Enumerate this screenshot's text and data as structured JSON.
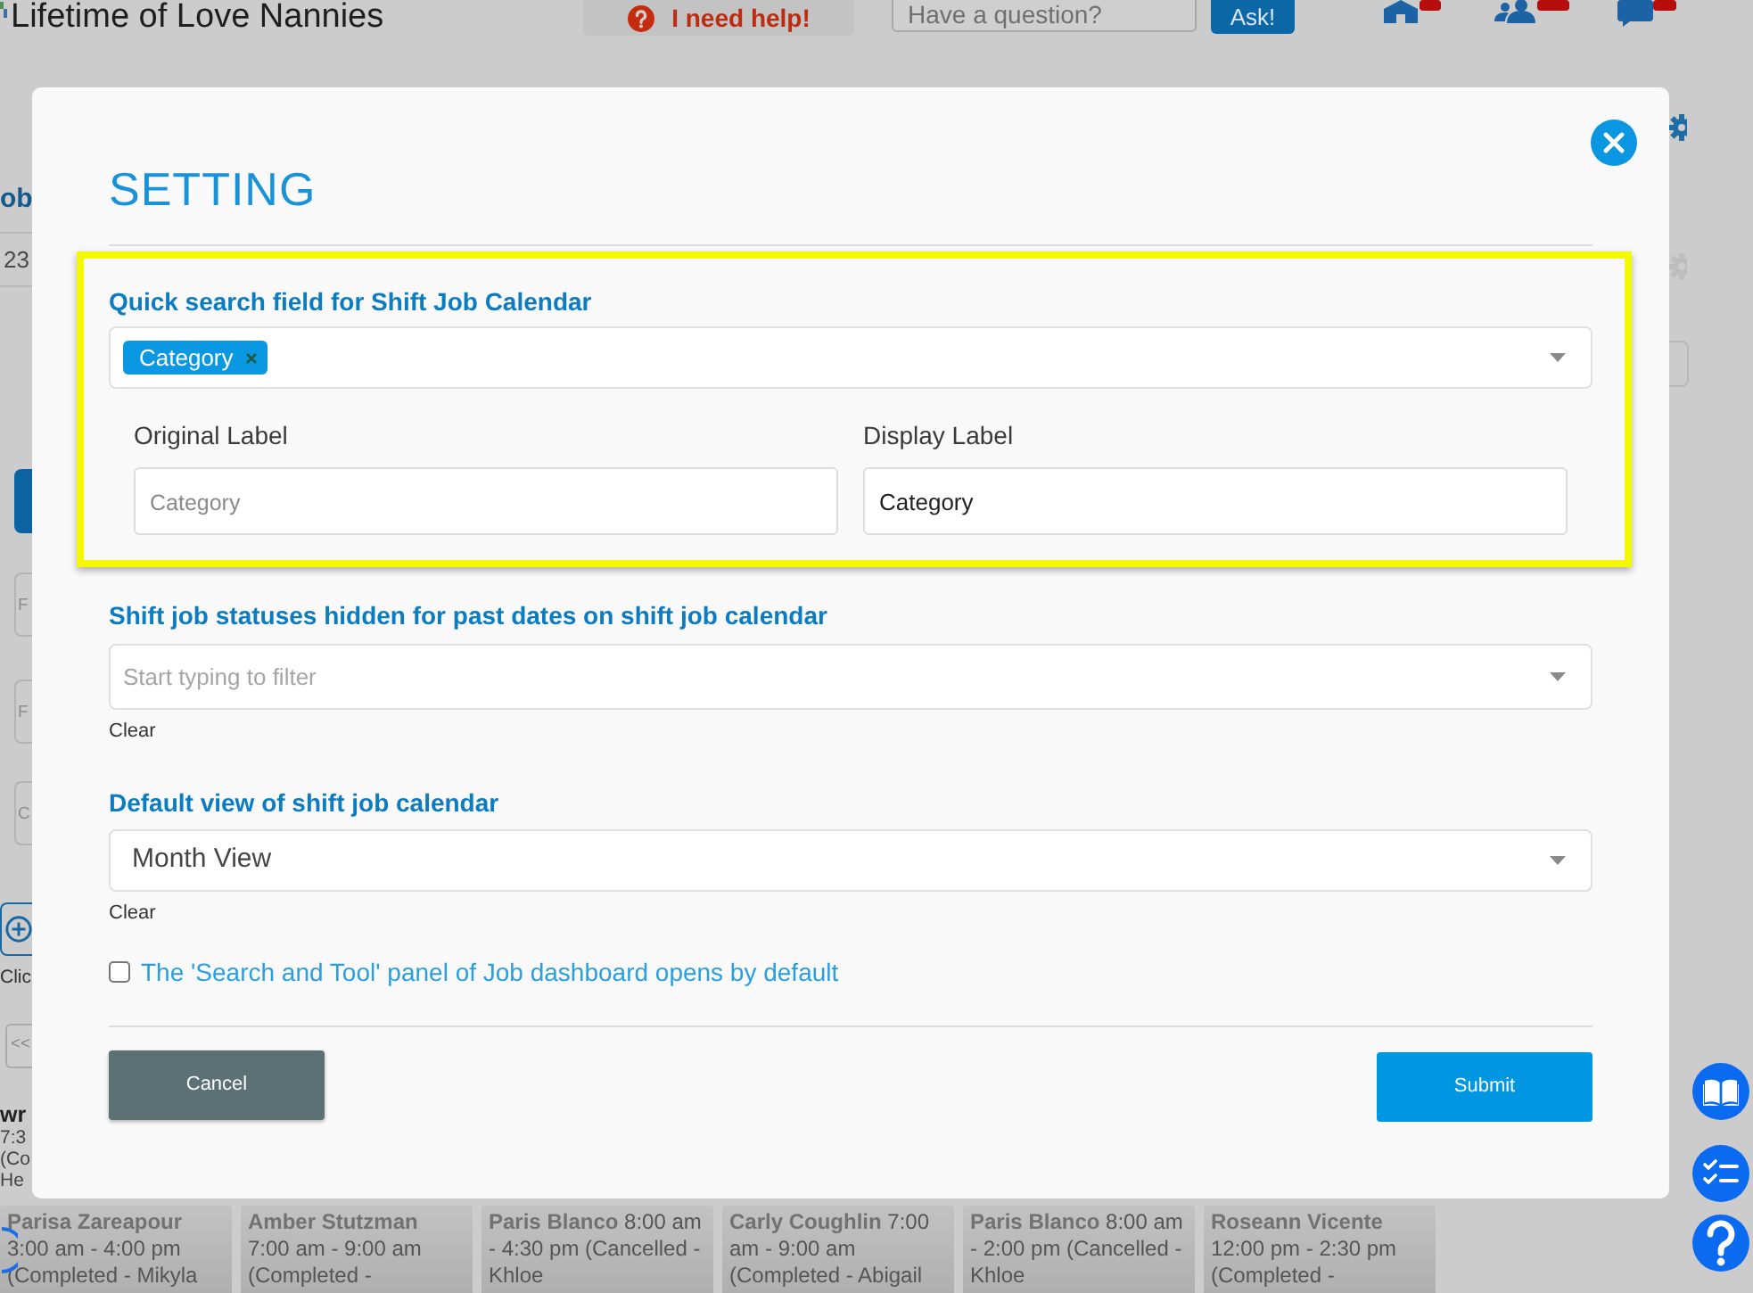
{
  "header": {
    "brand": "Lifetime of Love Nannies",
    "help_button": "I need help!",
    "question_field": {
      "placeholder": "Have a question?"
    },
    "ask_button": "Ask!"
  },
  "left_panel": {
    "heading": "ob",
    "row_value": "23",
    "filter_fields": [
      {
        "placeholder": "F"
      },
      {
        "placeholder": "F"
      },
      {
        "placeholder": "C"
      }
    ],
    "hint": "Clic",
    "pager_button": "<<",
    "event": {
      "title": "wr",
      "lines": [
        "7:3",
        "(Co",
        "He"
      ]
    }
  },
  "setting_dialog": {
    "title": "SETTING",
    "quick_search": {
      "highlighted": true,
      "label": "Quick search field for Shift Job Calendar",
      "tags": [
        "Category"
      ],
      "original_label": {
        "label": "Original Label",
        "placeholder": "Category"
      },
      "display_label": {
        "label": "Display Label",
        "value": "Category"
      }
    },
    "hidden_statuses": {
      "label": "Shift job statuses hidden for past dates on shift job calendar",
      "placeholder": "Start typing to filter",
      "clear": "Clear"
    },
    "default_view": {
      "label": "Default view of shift job calendar",
      "value": "Month View",
      "clear": "Clear"
    },
    "search_panel_default": {
      "label": "The 'Search and Tool' panel of Job dashboard opens by default",
      "checked": false
    },
    "buttons": {
      "cancel": "Cancel",
      "submit": "Submit"
    }
  },
  "calendar_events": [
    {
      "text": "**Parisa Zareapour** 3:00 am - 4:00 pm (Completed - Mikyla"
    },
    {
      "text": "**Amber Stutzman** 7:00 am - 9:00 am (Completed -"
    },
    {
      "text": "**Paris Blanco** 8:00 am - 4:30 pm (Cancelled - Khloe"
    },
    {
      "text": "**Carly Coughlin** 7:00 am - 9:00 am (Completed - Abigail"
    },
    {
      "text": "**Paris Blanco** 8:00 am - 2:00 pm (Cancelled - Khloe"
    },
    {
      "text": "**Roseann Vicente** 12:00 pm - 2:30 pm (Completed -"
    }
  ]
}
